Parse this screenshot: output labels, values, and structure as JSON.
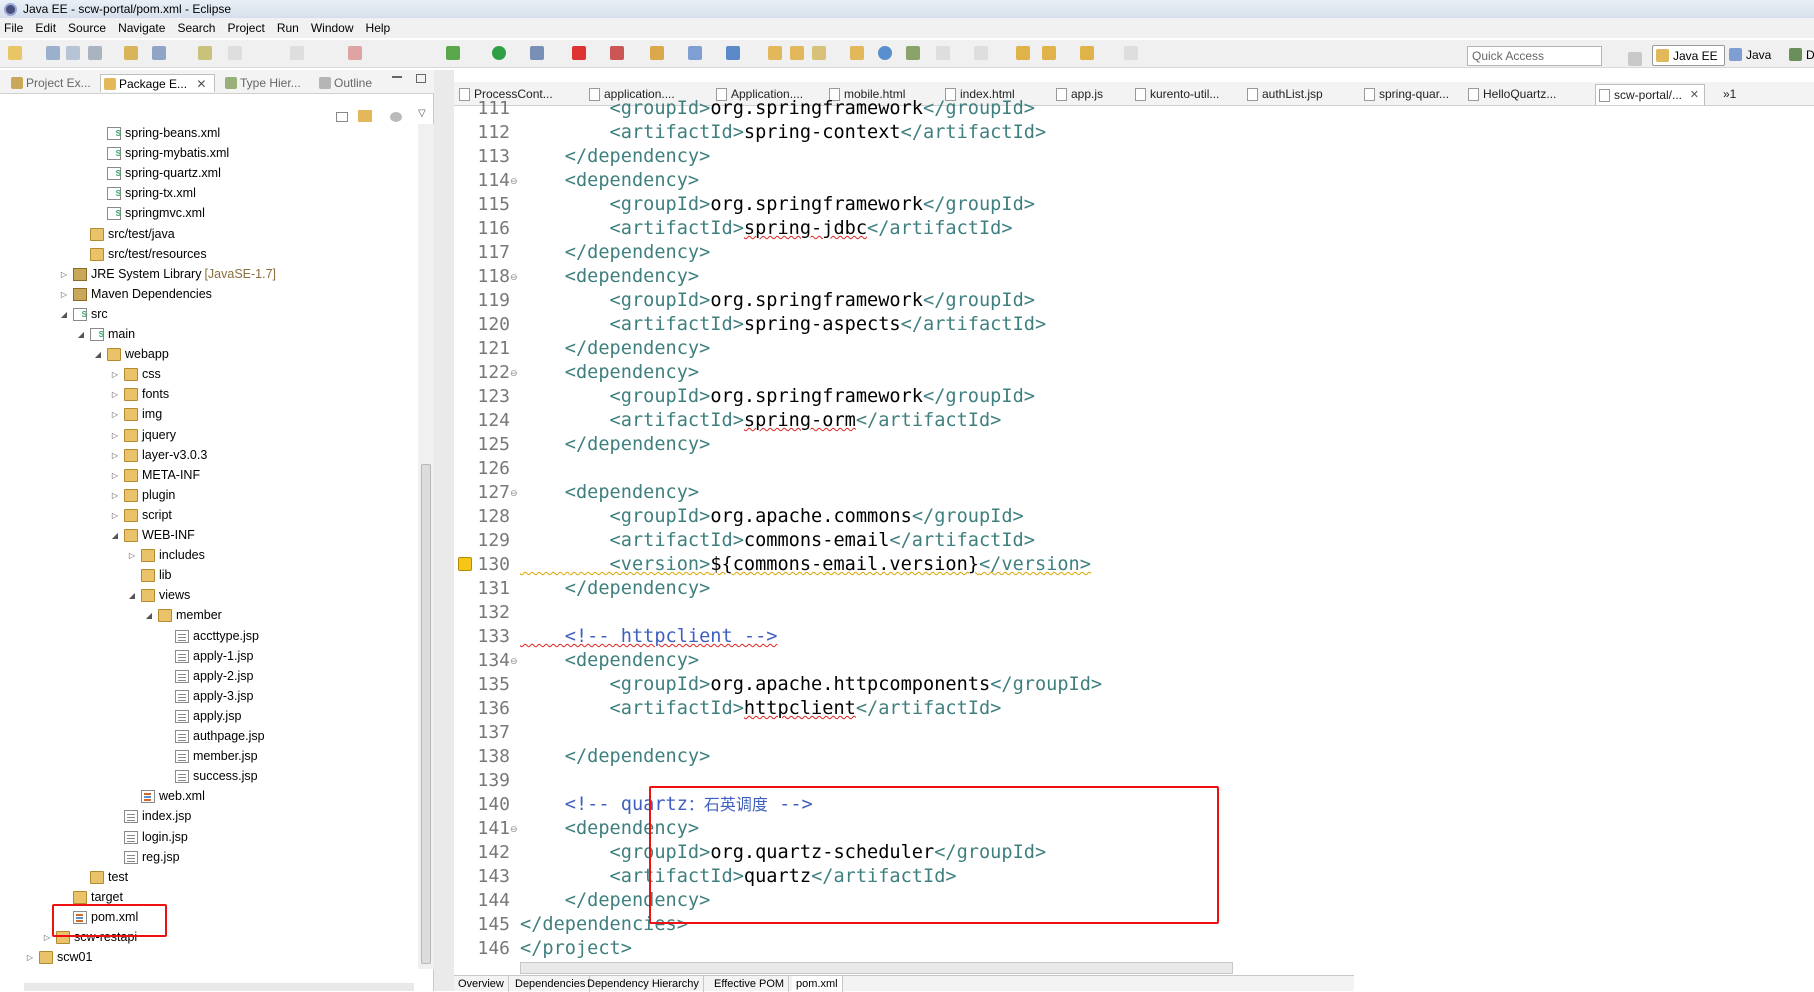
{
  "window": {
    "title": "Java EE - scw-portal/pom.xml - Eclipse"
  },
  "menu": [
    "File",
    "Edit",
    "Source",
    "Navigate",
    "Search",
    "Project",
    "Run",
    "Window",
    "Help"
  ],
  "toolbar": {
    "quick_access_placeholder": "Quick Access",
    "perspectives": [
      "Java EE",
      "Java",
      "D"
    ]
  },
  "left_tabs": [
    "Project Ex...",
    "Package E...",
    "Type Hier...",
    "Outline"
  ],
  "tree": [
    {
      "label": "spring-beans.xml",
      "indent": 5,
      "icon": "spring",
      "exp": ""
    },
    {
      "label": "spring-mybatis.xml",
      "indent": 5,
      "icon": "spring",
      "exp": ""
    },
    {
      "label": "spring-quartz.xml",
      "indent": 5,
      "icon": "spring",
      "exp": ""
    },
    {
      "label": "spring-tx.xml",
      "indent": 5,
      "icon": "spring",
      "exp": ""
    },
    {
      "label": "springmvc.xml",
      "indent": 5,
      "icon": "spring",
      "exp": ""
    },
    {
      "label": "src/test/java",
      "indent": 4,
      "icon": "pkgfolder",
      "exp": ""
    },
    {
      "label": "src/test/resources",
      "indent": 4,
      "icon": "pkgfolder",
      "exp": ""
    },
    {
      "label": "JRE System Library",
      "sub": "[JavaSE-1.7]",
      "indent": 3,
      "icon": "lib",
      "exp": "▷"
    },
    {
      "label": "Maven Dependencies",
      "indent": 3,
      "icon": "lib",
      "exp": "▷"
    },
    {
      "label": "src",
      "indent": 3,
      "icon": "spring",
      "exp": "◢"
    },
    {
      "label": "main",
      "indent": 4,
      "icon": "spring",
      "exp": "◢"
    },
    {
      "label": "webapp",
      "indent": 5,
      "icon": "folder",
      "exp": "◢"
    },
    {
      "label": "css",
      "indent": 6,
      "icon": "folder",
      "exp": "▷"
    },
    {
      "label": "fonts",
      "indent": 6,
      "icon": "folder",
      "exp": "▷"
    },
    {
      "label": "img",
      "indent": 6,
      "icon": "folder",
      "exp": "▷"
    },
    {
      "label": "jquery",
      "indent": 6,
      "icon": "folder",
      "exp": "▷"
    },
    {
      "label": "layer-v3.0.3",
      "indent": 6,
      "icon": "folder",
      "exp": "▷"
    },
    {
      "label": "META-INF",
      "indent": 6,
      "icon": "folder",
      "exp": "▷"
    },
    {
      "label": "plugin",
      "indent": 6,
      "icon": "folder",
      "exp": "▷"
    },
    {
      "label": "script",
      "indent": 6,
      "icon": "folder",
      "exp": "▷"
    },
    {
      "label": "WEB-INF",
      "indent": 6,
      "icon": "folder",
      "exp": "◢"
    },
    {
      "label": "includes",
      "indent": 7,
      "icon": "folder",
      "exp": "▷"
    },
    {
      "label": "lib",
      "indent": 7,
      "icon": "folder",
      "exp": ""
    },
    {
      "label": "views",
      "indent": 7,
      "icon": "folder",
      "exp": "◢"
    },
    {
      "label": "member",
      "indent": 8,
      "icon": "folder",
      "exp": "◢"
    },
    {
      "label": "accttype.jsp",
      "indent": 9,
      "icon": "jsp",
      "exp": ""
    },
    {
      "label": "apply-1.jsp",
      "indent": 9,
      "icon": "jsp",
      "exp": ""
    },
    {
      "label": "apply-2.jsp",
      "indent": 9,
      "icon": "jsp",
      "exp": ""
    },
    {
      "label": "apply-3.jsp",
      "indent": 9,
      "icon": "jsp",
      "exp": ""
    },
    {
      "label": "apply.jsp",
      "indent": 9,
      "icon": "jsp",
      "exp": ""
    },
    {
      "label": "authpage.jsp",
      "indent": 9,
      "icon": "jsp",
      "exp": ""
    },
    {
      "label": "member.jsp",
      "indent": 9,
      "icon": "jsp",
      "exp": ""
    },
    {
      "label": "success.jsp",
      "indent": 9,
      "icon": "jsp",
      "exp": ""
    },
    {
      "label": "web.xml",
      "indent": 7,
      "icon": "xml",
      "exp": ""
    },
    {
      "label": "index.jsp",
      "indent": 6,
      "icon": "jsp",
      "exp": ""
    },
    {
      "label": "login.jsp",
      "indent": 6,
      "icon": "jsp",
      "exp": ""
    },
    {
      "label": "reg.jsp",
      "indent": 6,
      "icon": "jsp",
      "exp": ""
    },
    {
      "label": "test",
      "indent": 4,
      "icon": "folder",
      "exp": ""
    },
    {
      "label": "target",
      "indent": 3,
      "icon": "folder",
      "exp": ""
    },
    {
      "label": "pom.xml",
      "indent": 3,
      "icon": "xml",
      "exp": ""
    },
    {
      "label": "scw-restapi",
      "indent": 2,
      "icon": "folder",
      "exp": "▷"
    },
    {
      "label": "scw01",
      "indent": 1,
      "icon": "folder",
      "exp": "▷"
    }
  ],
  "editor_tabs": [
    "ProcessCont...",
    "application....",
    "Application....",
    "mobile.html",
    "index.html",
    "app.js",
    "kurento-util...",
    "authList.jsp",
    "spring-quar...",
    "HelloQuartz...",
    "scw-portal/..."
  ],
  "editor_overflow": "»1",
  "code": [
    {
      "n": "111",
      "fold": "",
      "parts": [
        [
          "tag",
          "        <groupId>"
        ],
        [
          "txt",
          "org.springframework"
        ],
        [
          "tag",
          "</groupId>"
        ]
      ]
    },
    {
      "n": "112",
      "fold": "",
      "parts": [
        [
          "tag",
          "        <artifactId>"
        ],
        [
          "txt",
          "spring-context"
        ],
        [
          "tag",
          "</artifactId>"
        ]
      ]
    },
    {
      "n": "113",
      "fold": "",
      "parts": [
        [
          "tag",
          "    </dependency>"
        ]
      ]
    },
    {
      "n": "114",
      "fold": "⊖",
      "parts": [
        [
          "tag",
          "    <dependency>"
        ]
      ]
    },
    {
      "n": "115",
      "fold": "",
      "parts": [
        [
          "tag",
          "        <groupId>"
        ],
        [
          "txt",
          "org.springframework"
        ],
        [
          "tag",
          "</groupId>"
        ]
      ]
    },
    {
      "n": "116",
      "fold": "",
      "parts": [
        [
          "tag",
          "        <artifactId>"
        ],
        [
          "txt",
          "spring-jdbc"
        ],
        [
          "tag",
          "</artifactId>"
        ]
      ]
    },
    {
      "n": "117",
      "fold": "",
      "parts": [
        [
          "tag",
          "    </dependency>"
        ]
      ]
    },
    {
      "n": "118",
      "fold": "⊖",
      "parts": [
        [
          "tag",
          "    <dependency>"
        ]
      ]
    },
    {
      "n": "119",
      "fold": "",
      "parts": [
        [
          "tag",
          "        <groupId>"
        ],
        [
          "txt",
          "org.springframework"
        ],
        [
          "tag",
          "</groupId>"
        ]
      ]
    },
    {
      "n": "120",
      "fold": "",
      "parts": [
        [
          "tag",
          "        <artifactId>"
        ],
        [
          "txt",
          "spring-aspects"
        ],
        [
          "tag",
          "</artifactId>"
        ]
      ]
    },
    {
      "n": "121",
      "fold": "",
      "parts": [
        [
          "tag",
          "    </dependency>"
        ]
      ]
    },
    {
      "n": "122",
      "fold": "⊖",
      "parts": [
        [
          "tag",
          "    <dependency>"
        ]
      ]
    },
    {
      "n": "123",
      "fold": "",
      "parts": [
        [
          "tag",
          "        <groupId>"
        ],
        [
          "txt",
          "org.springframework"
        ],
        [
          "tag",
          "</groupId>"
        ]
      ]
    },
    {
      "n": "124",
      "fold": "",
      "parts": [
        [
          "tag",
          "        <artifactId>"
        ],
        [
          "txt",
          "spring-orm"
        ],
        [
          "tag",
          "</artifactId>"
        ]
      ]
    },
    {
      "n": "125",
      "fold": "",
      "parts": [
        [
          "tag",
          "    </dependency>"
        ]
      ]
    },
    {
      "n": "126",
      "fold": "",
      "parts": []
    },
    {
      "n": "127",
      "fold": "⊖",
      "parts": [
        [
          "tag",
          "    <dependency>"
        ]
      ]
    },
    {
      "n": "128",
      "fold": "",
      "parts": [
        [
          "tag",
          "        <groupId>"
        ],
        [
          "txt",
          "org.apache.commons"
        ],
        [
          "tag",
          "</groupId>"
        ]
      ]
    },
    {
      "n": "129",
      "fold": "",
      "parts": [
        [
          "tag",
          "        <artifactId>"
        ],
        [
          "txt",
          "commons-email"
        ],
        [
          "tag",
          "</artifactId>"
        ]
      ]
    },
    {
      "n": "130",
      "fold": "",
      "parts": [
        [
          "tag",
          "        <version>"
        ],
        [
          "txt",
          "${commons-email.version}"
        ],
        [
          "tag",
          "</version>"
        ]
      ]
    },
    {
      "n": "131",
      "fold": "",
      "parts": [
        [
          "tag",
          "    </dependency>"
        ]
      ]
    },
    {
      "n": "132",
      "fold": "",
      "parts": []
    },
    {
      "n": "133",
      "fold": "",
      "parts": [
        [
          "cmt",
          "    <!-- httpclient -->"
        ]
      ]
    },
    {
      "n": "134",
      "fold": "⊖",
      "parts": [
        [
          "tag",
          "    <dependency>"
        ]
      ]
    },
    {
      "n": "135",
      "fold": "",
      "parts": [
        [
          "tag",
          "        <groupId>"
        ],
        [
          "txt",
          "org.apache.httpcomponents"
        ],
        [
          "tag",
          "</groupId>"
        ]
      ]
    },
    {
      "n": "136",
      "fold": "",
      "parts": [
        [
          "tag",
          "        <artifactId>"
        ],
        [
          "txt",
          "httpclient"
        ],
        [
          "tag",
          "</artifactId>"
        ]
      ]
    },
    {
      "n": "137",
      "fold": "",
      "parts": []
    },
    {
      "n": "138",
      "fold": "",
      "parts": [
        [
          "tag",
          "    </dependency>"
        ]
      ]
    },
    {
      "n": "139",
      "fold": "",
      "parts": []
    },
    {
      "n": "140",
      "fold": "",
      "parts": [
        [
          "cmt",
          "    <!-- quartz"
        ],
        [
          "cjk",
          "：石英调度"
        ],
        [
          "cmt",
          " -->"
        ]
      ]
    },
    {
      "n": "141",
      "fold": "⊖",
      "parts": [
        [
          "tag",
          "    <dependency>"
        ]
      ]
    },
    {
      "n": "142",
      "fold": "",
      "parts": [
        [
          "tag",
          "        <groupId>"
        ],
        [
          "txt",
          "org.quartz-scheduler"
        ],
        [
          "tag",
          "</groupId>"
        ]
      ]
    },
    {
      "n": "143",
      "fold": "",
      "parts": [
        [
          "tag",
          "        <artifactId>"
        ],
        [
          "txt",
          "quartz"
        ],
        [
          "tag",
          "</artifactId>"
        ]
      ]
    },
    {
      "n": "144",
      "fold": "",
      "parts": [
        [
          "tag",
          "    </dependency>"
        ]
      ]
    },
    {
      "n": "145",
      "fold": "",
      "parts": [
        [
          "tag",
          "</dependencies>"
        ]
      ]
    },
    {
      "n": "146",
      "fold": "",
      "parts": [
        [
          "tag",
          "</project>"
        ]
      ]
    }
  ],
  "bottom_tabs": [
    "Overview",
    "Dependencies",
    "Dependency Hierarchy",
    "Effective POM",
    "pom.xml"
  ]
}
